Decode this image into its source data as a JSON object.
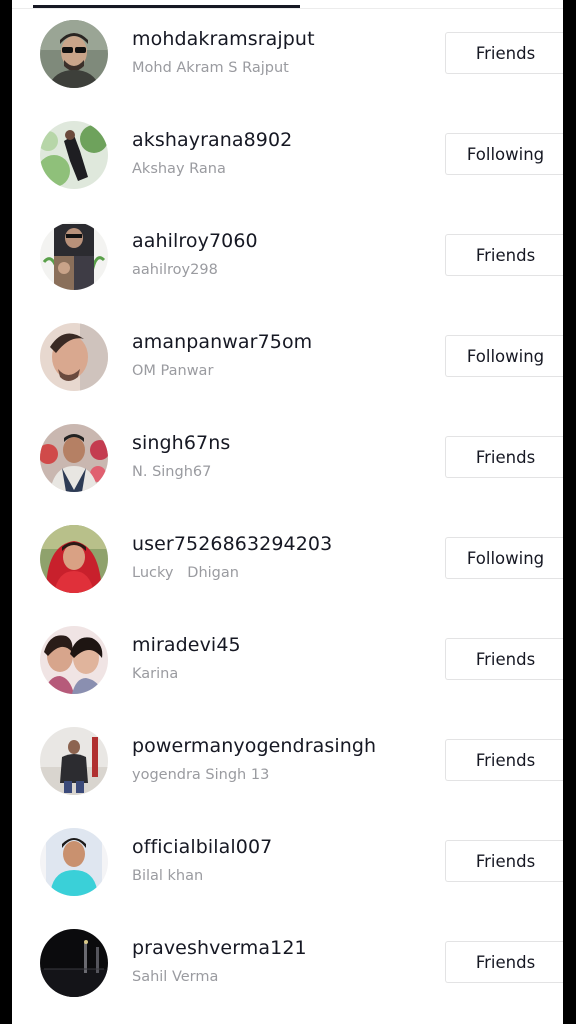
{
  "users": [
    {
      "username": "mohdakramsrajput",
      "nickname": "Mohd Akram S Rajput",
      "status": "Friends",
      "avatar": "man-sunglasses-photo"
    },
    {
      "username": "akshayrana8902",
      "nickname": "Akshay Rana",
      "status": "Following",
      "avatar": "outdoor-person-photo"
    },
    {
      "username": "aahilroy7060",
      "nickname": "aahilroy298",
      "status": "Friends",
      "avatar": "collage-photo"
    },
    {
      "username": "amanpanwar75om",
      "nickname": "OM Panwar",
      "status": "Following",
      "avatar": "portrait-photo"
    },
    {
      "username": "singh67ns",
      "nickname": "N. Singh67",
      "status": "Friends",
      "avatar": "older-man-photo"
    },
    {
      "username": "user7526863294203",
      "nickname": "Lucky   Dhigan",
      "status": "Following",
      "avatar": "woman-red-saree-photo"
    },
    {
      "username": "miradevi45",
      "nickname": "Karina",
      "status": "Friends",
      "avatar": "two-women-photo"
    },
    {
      "username": "powermanyogendrasingh",
      "nickname": "yogendra Singh 13",
      "status": "Friends",
      "avatar": "man-standing-photo"
    },
    {
      "username": "officialbilal007",
      "nickname": "Bilal khan",
      "status": "Friends",
      "avatar": "young-man-photo"
    },
    {
      "username": "praveshverma121",
      "nickname": "Sahil Verma",
      "status": "Friends",
      "avatar": "night-scene-photo"
    }
  ],
  "colors": {
    "background": "#ffffff",
    "frame": "#000000",
    "primary_text": "#161823",
    "secondary_text": "#9a9ba0",
    "button_border": "#e3e3e4"
  }
}
